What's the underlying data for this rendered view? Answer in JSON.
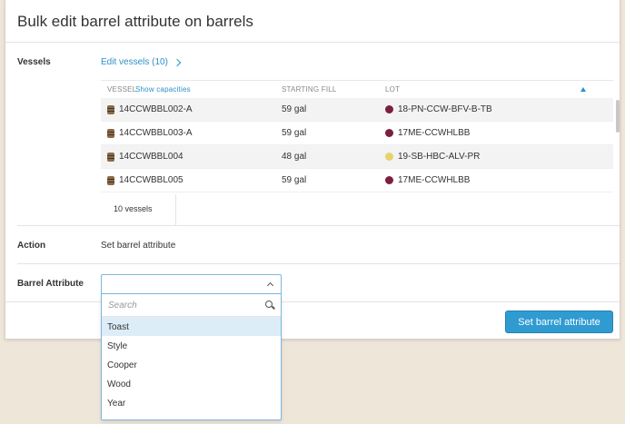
{
  "modal": {
    "title": "Bulk edit barrel attribute on barrels"
  },
  "vessels_section": {
    "label": "Vessels",
    "edit_link": "Edit vessels (10)",
    "columns": {
      "vessel": "VESSEL",
      "show_capacities": "Show capacities",
      "starting_fill": "STARTING FILL",
      "lot": "LOT"
    },
    "rows": [
      {
        "vessel": "14CCWBBL002-A",
        "fill": "59 gal",
        "lot": "18-PN-CCW-BFV-B-TB",
        "lot_color": "#7a1f3d"
      },
      {
        "vessel": "14CCWBBL003-A",
        "fill": "59 gal",
        "lot": "17ME-CCWHLBB",
        "lot_color": "#7a1f3d"
      },
      {
        "vessel": "14CCWBBL004",
        "fill": "48 gal",
        "lot": "19-SB-HBC-ALV-PR",
        "lot_color": "#e8d26a"
      },
      {
        "vessel": "14CCWBBL005",
        "fill": "59 gal",
        "lot": "17ME-CCWHLBB",
        "lot_color": "#7a1f3d"
      }
    ],
    "count": "10 vessels"
  },
  "action": {
    "label": "Action",
    "value": "Set barrel attribute"
  },
  "barrel_attribute": {
    "label": "Barrel Attribute",
    "search_placeholder": "Search",
    "options": [
      "Toast",
      "Style",
      "Cooper",
      "Wood",
      "Year"
    ],
    "highlighted": "Toast"
  },
  "footer": {
    "submit_label": "Set barrel attribute"
  },
  "colors": {
    "accent": "#2f9bd1",
    "link": "#2f8fc8",
    "background": "#efe6da"
  }
}
